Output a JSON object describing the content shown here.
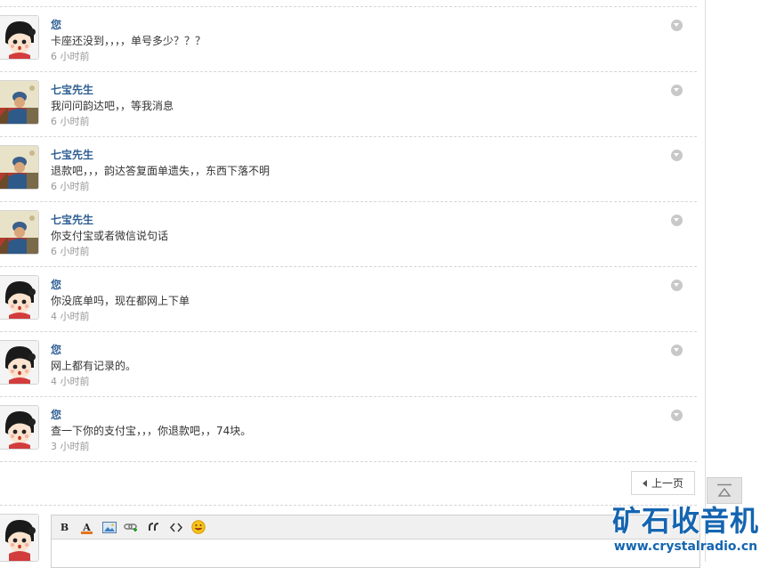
{
  "messages": [
    {
      "author": "您",
      "avatar": "girl",
      "text": "卡座还没到，，，，单号多少？？？",
      "time": "6 小时前"
    },
    {
      "author": "七宝先生",
      "avatar": "soldier",
      "text": "我问问韵达吧，，等我消息",
      "time": "6 小时前"
    },
    {
      "author": "七宝先生",
      "avatar": "soldier",
      "text": "退款吧，，，韵达答复面单遗失，，东西下落不明",
      "time": "6 小时前"
    },
    {
      "author": "七宝先生",
      "avatar": "soldier",
      "text": "你支付宝或者微信说句话",
      "time": "6 小时前"
    },
    {
      "author": "您",
      "avatar": "girl",
      "text": "你没底单吗，现在都网上下单",
      "time": "4 小时前"
    },
    {
      "author": "您",
      "avatar": "girl",
      "text": "网上都有记录的。",
      "time": "4 小时前"
    },
    {
      "author": "您",
      "avatar": "girl",
      "text": "查一下你的支付宝，，，你退款吧，，74块。",
      "time": "3 小时前"
    }
  ],
  "pagination": {
    "prev_label": "上一页"
  },
  "editor": {
    "tools": [
      "bold-icon",
      "font-color-icon",
      "image-icon",
      "link-icon",
      "quote-icon",
      "code-icon",
      "emoji-icon"
    ],
    "bold_label": "B",
    "color_label": "A"
  },
  "watermark": {
    "title": "矿石收音机",
    "url": "www.crystalradio.cn"
  },
  "colors": {
    "author": "#2f5f93",
    "time": "#999999",
    "watermark": "#1565b0"
  }
}
